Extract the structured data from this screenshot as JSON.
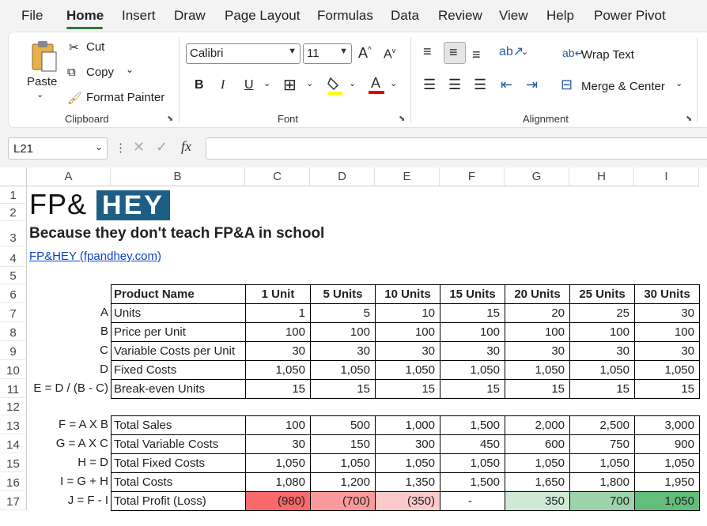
{
  "menu": [
    "File",
    "Home",
    "Insert",
    "Draw",
    "Page Layout",
    "Formulas",
    "Data",
    "Review",
    "View",
    "Help",
    "Power Pivot"
  ],
  "ribbon": {
    "clipboard": {
      "paste": "Paste",
      "cut": "Cut",
      "copy": "Copy",
      "format_painter": "Format Painter",
      "label": "Clipboard"
    },
    "font": {
      "name": "Calibri",
      "size": "11",
      "label": "Font",
      "bold": "B",
      "italic": "I",
      "underline": "U"
    },
    "alignment": {
      "wrap_text": "Wrap Text",
      "merge_center": "Merge & Center",
      "label": "Alignment"
    }
  },
  "formula_bar": {
    "name_box": "L21",
    "fx": "fx",
    "formula": ""
  },
  "columns": [
    "A",
    "B",
    "C",
    "D",
    "E",
    "F",
    "G",
    "H",
    "I"
  ],
  "rows": [
    "1",
    "2",
    "3",
    "4",
    "5",
    "6",
    "7",
    "8",
    "9",
    "10",
    "11",
    "12",
    "13",
    "14",
    "15",
    "16",
    "17"
  ],
  "sheet": {
    "logo_left": "FP&",
    "logo_right": "HEY",
    "title": "Because they don't teach FP&A in school",
    "link": "FP&HEY (fpandhey.com)",
    "table1": {
      "headers": [
        "Product Name",
        "1 Unit",
        "5 Units",
        "10 Units",
        "15 Units",
        "20 Units",
        "25 Units",
        "30 Units"
      ],
      "rows": [
        {
          "label": "A",
          "name": "Units",
          "values": [
            "1",
            "5",
            "10",
            "15",
            "20",
            "25",
            "30"
          ]
        },
        {
          "label": "B",
          "name": "Price per Unit",
          "values": [
            "100",
            "100",
            "100",
            "100",
            "100",
            "100",
            "100"
          ]
        },
        {
          "label": "C",
          "name": "Variable Costs per Unit",
          "values": [
            "30",
            "30",
            "30",
            "30",
            "30",
            "30",
            "30"
          ]
        },
        {
          "label": "D",
          "name": "Fixed Costs",
          "values": [
            "1,050",
            "1,050",
            "1,050",
            "1,050",
            "1,050",
            "1,050",
            "1,050"
          ]
        },
        {
          "label": "E = D / (B - C)",
          "name": "Break-even Units",
          "values": [
            "15",
            "15",
            "15",
            "15",
            "15",
            "15",
            "15"
          ]
        }
      ]
    },
    "table2": {
      "rows": [
        {
          "label": "F = A X B",
          "name": "Total Sales",
          "values": [
            "100",
            "500",
            "1,000",
            "1,500",
            "2,000",
            "2,500",
            "3,000"
          ]
        },
        {
          "label": "G = A X C",
          "name": "Total Variable Costs",
          "values": [
            "30",
            "150",
            "300",
            "450",
            "600",
            "750",
            "900"
          ]
        },
        {
          "label": "H = D",
          "name": "Total Fixed Costs",
          "values": [
            "1,050",
            "1,050",
            "1,050",
            "1,050",
            "1,050",
            "1,050",
            "1,050"
          ]
        },
        {
          "label": "I = G + H",
          "name": "Total Costs",
          "values": [
            "1,080",
            "1,200",
            "1,350",
            "1,500",
            "1,650",
            "1,800",
            "1,950"
          ]
        },
        {
          "label": "J = F - I",
          "name": "Total Profit (Loss)",
          "values": [
            "(980)",
            "(700)",
            "(350)",
            "-",
            "350",
            "700",
            "1,050"
          ]
        }
      ],
      "profit_colors": [
        "#f8696b",
        "#fa9a9b",
        "#fcc9ca",
        "#ffffff",
        "#cfe9d4",
        "#9dd3ab",
        "#63be7b"
      ]
    }
  }
}
